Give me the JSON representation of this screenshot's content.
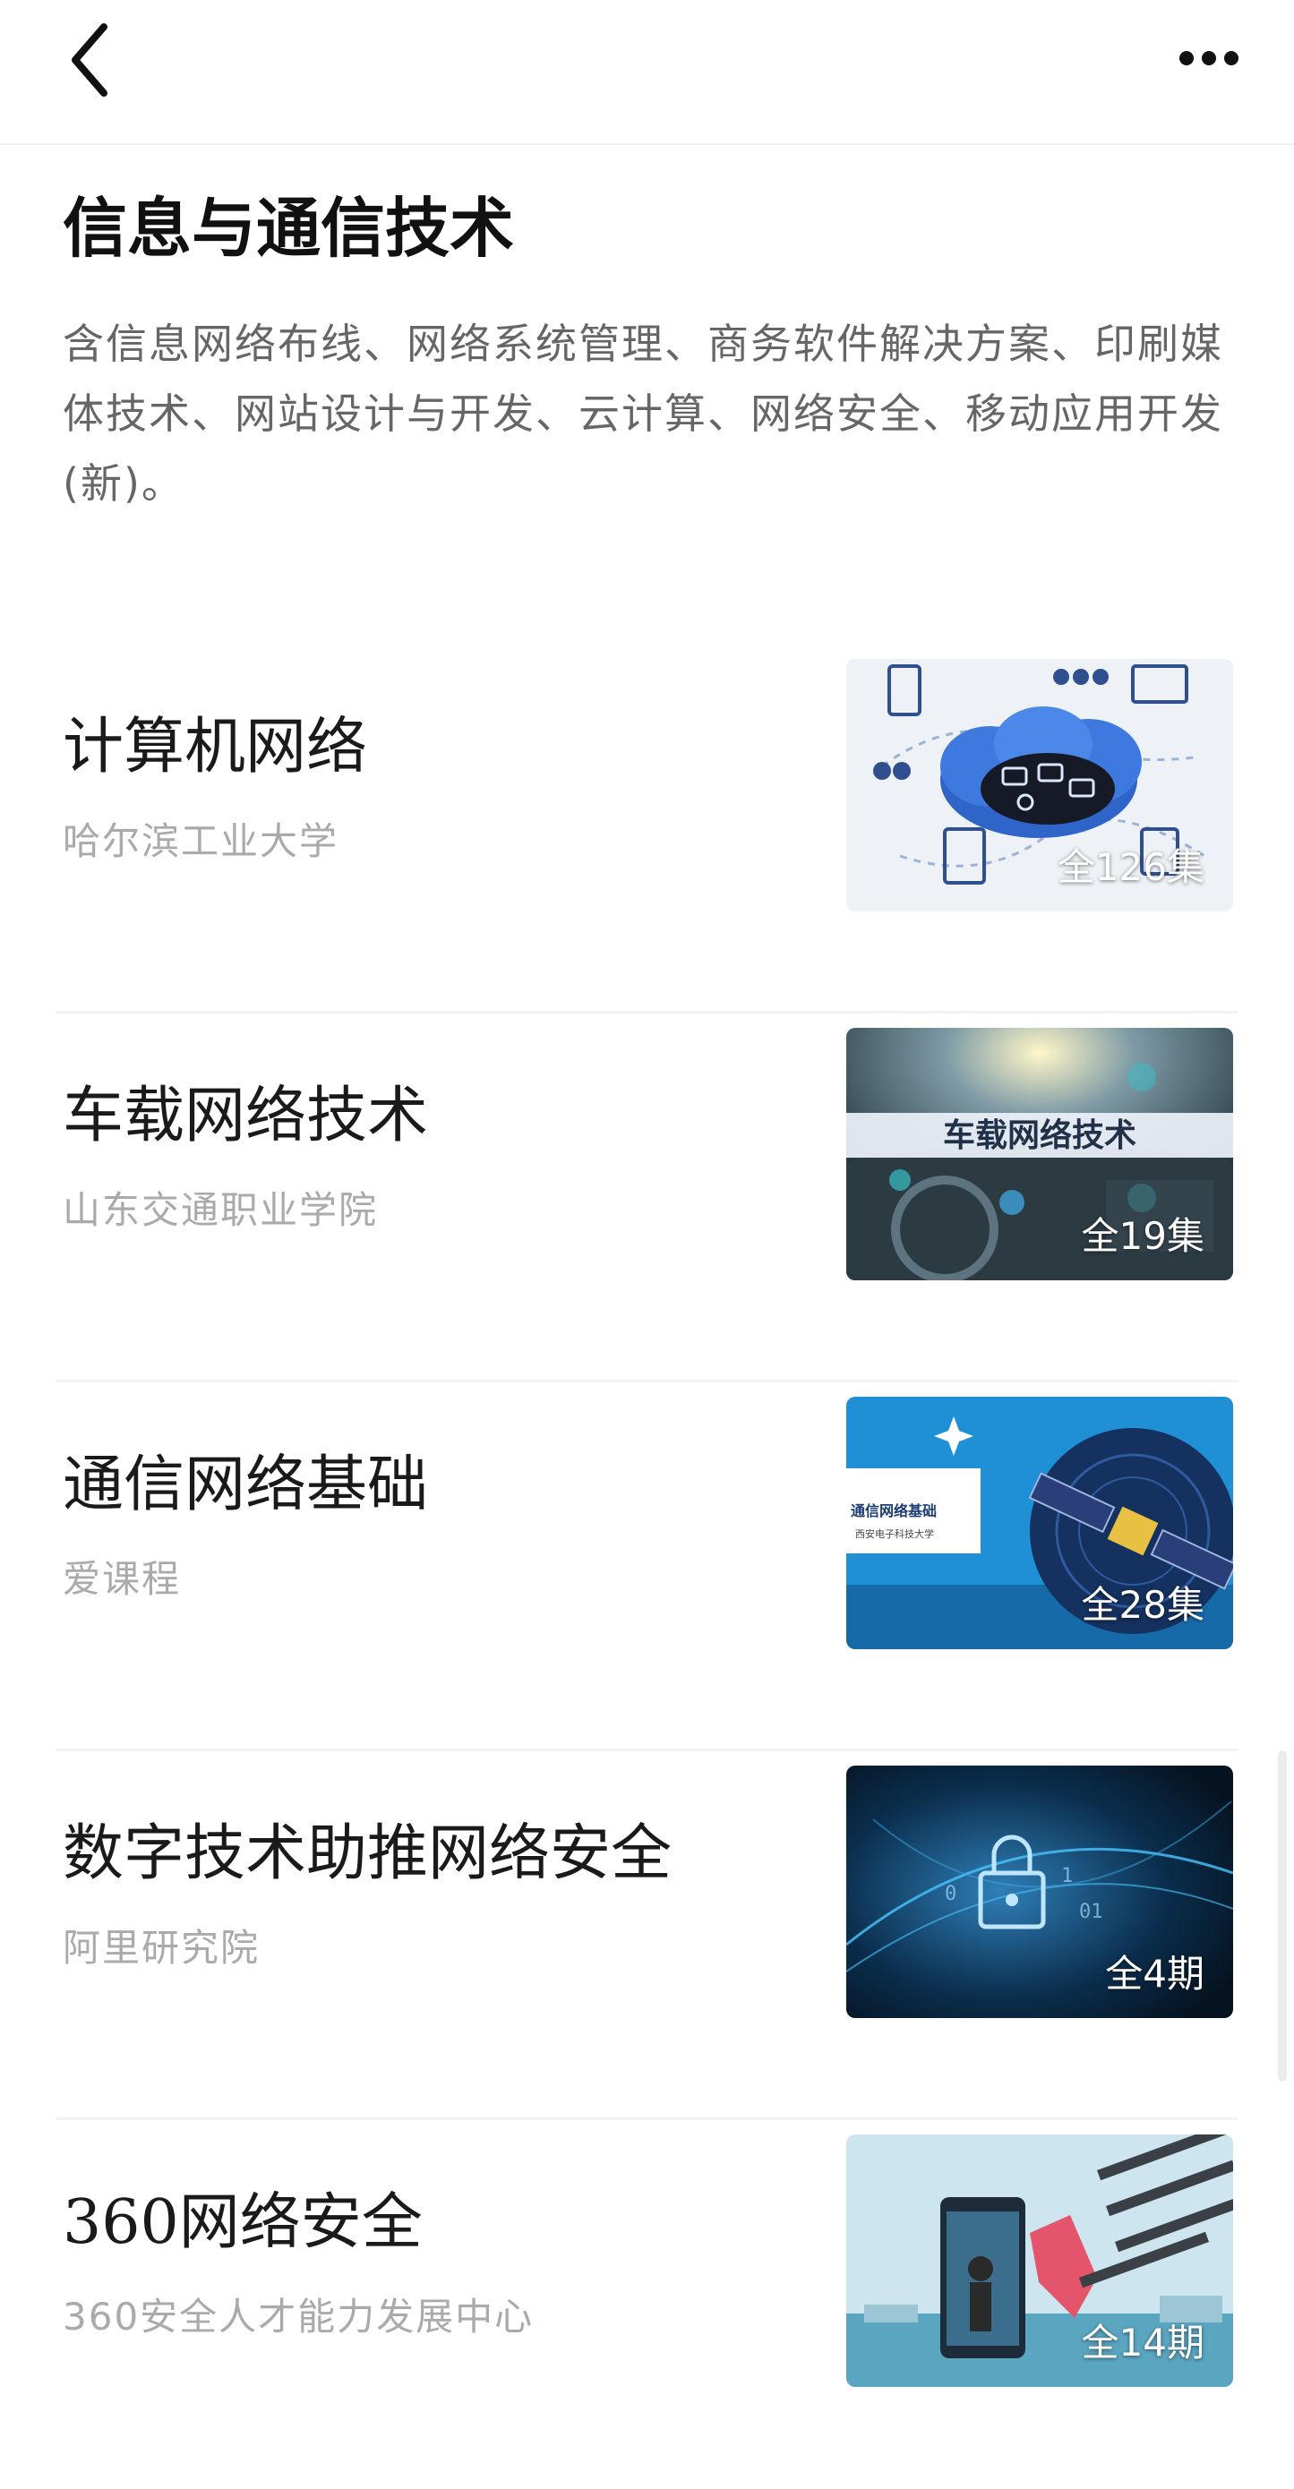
{
  "nav": {
    "back_icon": "chevron-left-icon",
    "more_icon": "more-dots-icon"
  },
  "page": {
    "title": "信息与通信技术",
    "description": "含信息网络布线、网络系统管理、商务软件解决方案、印刷媒体技术、网站设计与开发、云计算、网络安全、移动应用开发(新)。"
  },
  "courses": [
    {
      "title": "计算机网络",
      "provider": "哈尔滨工业大学",
      "episodes": "全126集"
    },
    {
      "title": "车载网络技术",
      "provider": "山东交通职业学院",
      "episodes": "全19集",
      "thumb_text": "车载网络技术"
    },
    {
      "title": "通信网络基础",
      "provider": "爱课程",
      "episodes": "全28集",
      "thumb_text": "通信网络基础",
      "thumb_subtext": "西安电子科技大学"
    },
    {
      "title": "数字技术助推网络安全",
      "provider": "阿里研究院",
      "episodes": "全4期"
    },
    {
      "title": "360网络安全",
      "provider": "360安全人才能力发展中心",
      "episodes": "全14期"
    }
  ]
}
